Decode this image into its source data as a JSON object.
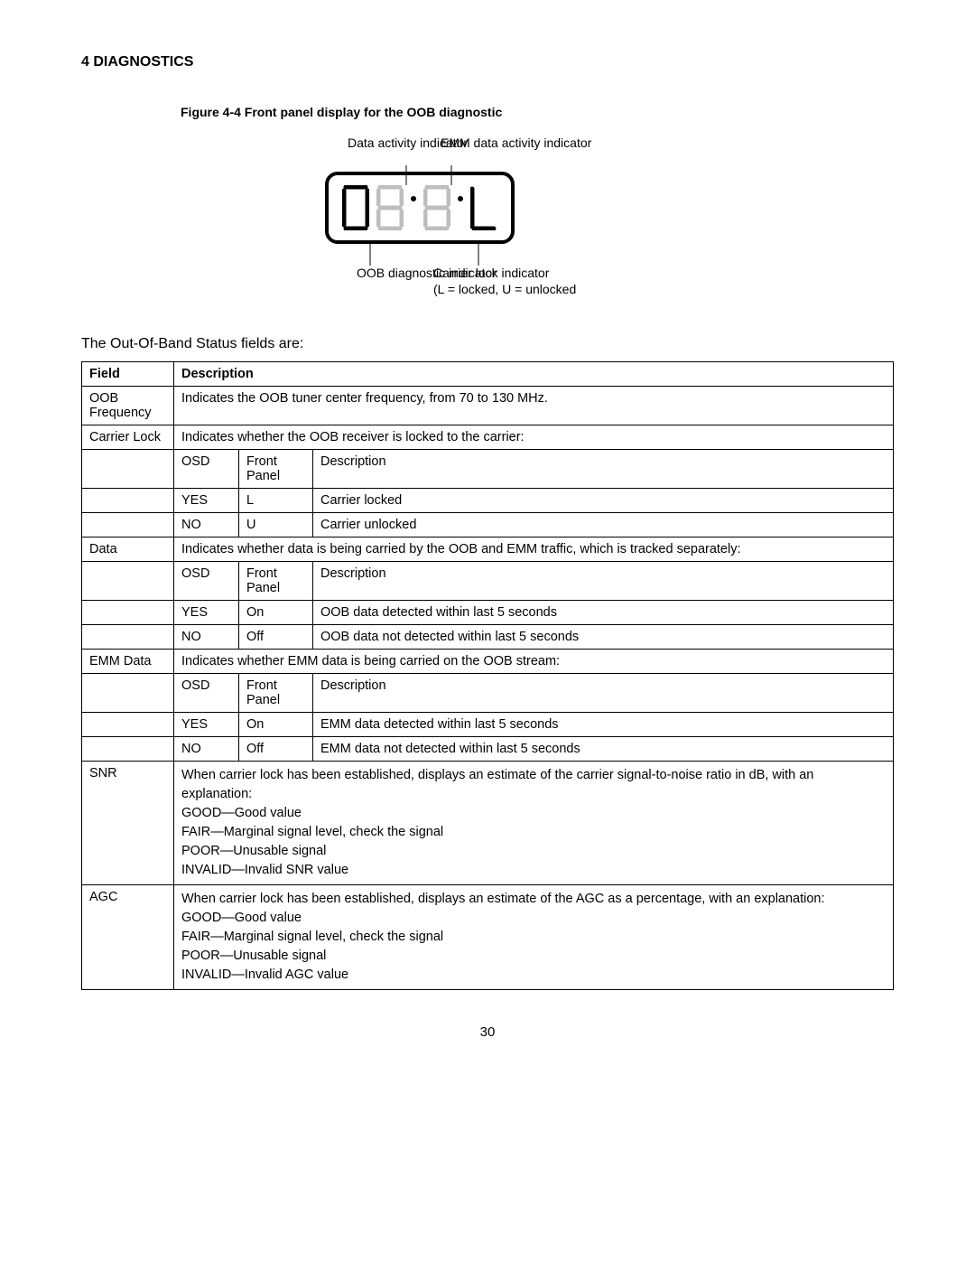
{
  "section_heading": "4 DIAGNOSTICS",
  "figure_caption": "Figure 4-4 Front panel display for the OOB diagnostic",
  "diagram": {
    "top_left": "Data activity indicator",
    "top_right": "EMM data activity indicator",
    "bottom_left": "OOB diagnostic indicator",
    "bottom_right_l1": "Carrier lock indicator",
    "bottom_right_l2": "(L = locked, U = unlocked"
  },
  "intro_line": "The Out-Of-Band Status fields are:",
  "headers": {
    "field": "Field",
    "description": "Description"
  },
  "sub_headers": {
    "osd": "OSD",
    "front_panel": "Front Panel",
    "desc": "Description"
  },
  "rows": {
    "oob_freq_field": "OOB Frequency",
    "oob_freq_desc": "Indicates the OOB tuner center frequency, from 70 to 130 MHz.",
    "carrier_lock_field": "Carrier Lock",
    "carrier_lock_desc": "Indicates whether the OOB receiver is locked to the carrier:",
    "cl_yes_osd": "YES",
    "cl_yes_fp": "L",
    "cl_yes_d": "Carrier locked",
    "cl_no_osd": "NO",
    "cl_no_fp": "U",
    "cl_no_d": "Carrier unlocked",
    "data_field": "Data",
    "data_desc": "Indicates whether data is being carried by the OOB and EMM traffic, which is tracked separately:",
    "d_yes_osd": "YES",
    "d_yes_fp": "On",
    "d_yes_d": "OOB data detected within last 5 seconds",
    "d_no_osd": "NO",
    "d_no_fp": "Off",
    "d_no_d": "OOB data not detected within last 5 seconds",
    "emm_field": "EMM Data",
    "emm_desc": "Indicates whether EMM data is being carried on the OOB stream:",
    "e_yes_osd": "YES",
    "e_yes_fp": "On",
    "e_yes_d": "EMM data detected within last 5 seconds",
    "e_no_osd": "NO",
    "e_no_fp": "Off",
    "e_no_d": "EMM data not detected within last 5 seconds",
    "snr_field": "SNR",
    "snr_l1": "When carrier lock has been established, displays an estimate of the carrier signal-to-noise ratio in dB, with an explanation:",
    "snr_l2": "GOOD—Good value",
    "snr_l3": "FAIR—Marginal signal level, check the signal",
    "snr_l4": "POOR—Unusable signal",
    "snr_l5": "INVALID—Invalid SNR value",
    "agc_field": "AGC",
    "agc_l1": "When carrier lock has been established, displays an estimate of the AGC as a percentage, with an explanation:",
    "agc_l2": "GOOD—Good value",
    "agc_l3": "FAIR—Marginal signal level, check the signal",
    "agc_l4": "POOR—Unusable signal",
    "agc_l5": "INVALID—Invalid AGC value"
  },
  "page_number": "30"
}
